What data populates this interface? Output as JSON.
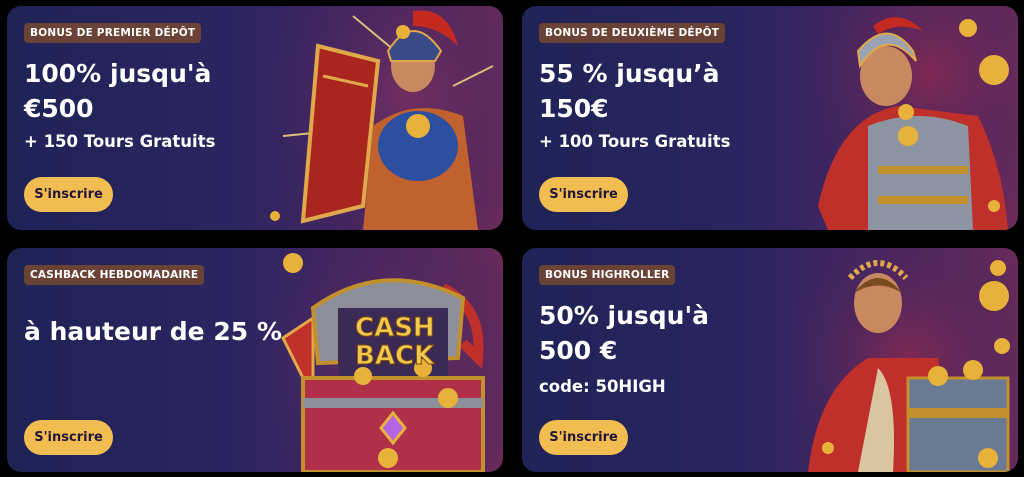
{
  "promotions": [
    {
      "badge": "BONUS DE PREMIER DÉPÔT",
      "headline_line1": "100% jusqu'à",
      "headline_line2": "€500",
      "subline": "+ 150 Tours Gratuits",
      "button_label": "S'inscrire",
      "artwork_icon": "spartan-warrior-shield-icon"
    },
    {
      "badge": "BONUS DE DEUXIÈME DÉPÔT",
      "headline_line1": "55 % jusqu’à",
      "headline_line2": "150€",
      "subline": "+ 100 Tours Gratuits",
      "button_label": "S'inscrire",
      "artwork_icon": "roman-centurion-icon"
    },
    {
      "badge": "CASHBACK HEBDOMADAIRE",
      "headline_line1": "à hauteur de 25 %",
      "button_label": "S'inscrire",
      "artwork_icon": "cashback-treasure-chest-icon",
      "artwork_text_top": "CASH",
      "artwork_text_bottom": "BACK"
    },
    {
      "badge": "BONUS HIGHROLLER",
      "headline_line1": "50% jusqu'à",
      "headline_line2": "500 €",
      "subline": "code: 50HIGH",
      "button_label": "S'inscrire",
      "artwork_icon": "roman-emperor-icon"
    }
  ],
  "colors": {
    "page_background": "#000000",
    "card_gradient_start": "#1f2356",
    "card_gradient_end": "#6a2a5a",
    "badge_background": "#6b4336",
    "button_background": "#f2bd50",
    "button_text": "#22173a",
    "text": "#ffffff",
    "gold": "#e8b23a"
  }
}
